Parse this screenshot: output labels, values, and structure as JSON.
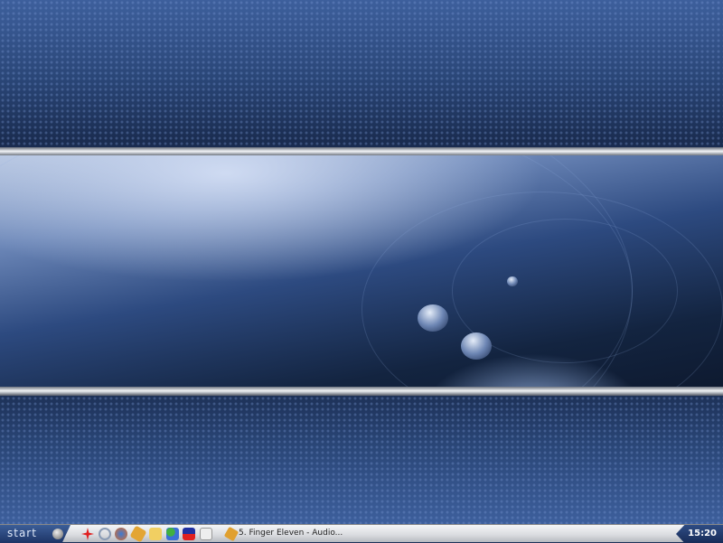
{
  "taskbar": {
    "start_label": "start",
    "quick_launch": [
      "red-splat-icon",
      "link-icon",
      "firefox-icon",
      "winamp-icon",
      "winamp-icon-2",
      "folder-icon",
      "messenger-icon",
      "app-icon",
      "mail-icon"
    ],
    "task_button": {
      "label": "5. Finger Eleven - Audio..."
    },
    "clock": "15:20"
  }
}
